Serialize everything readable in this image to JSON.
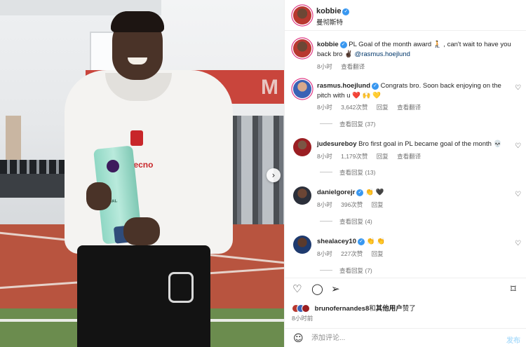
{
  "post": {
    "author": "kobbie",
    "location": "曼彻斯特"
  },
  "caption": {
    "username": "kobbie",
    "text_before": "PL Goal of the month award 🧎 , can't wait to have you back bro ✌🏿 ",
    "mention": "@rasmus.hoejlund",
    "time": "8小时",
    "translate": "查看翻译"
  },
  "comments": [
    {
      "username": "rasmus.hoejlund",
      "verified": true,
      "text": "Congrats bro. Soon back enjoying on the pitch with u ❤️ 🙌 💛",
      "time": "8小时",
      "likes": "3,642次赞",
      "reply": "回复",
      "translate": "查看翻译",
      "view_replies": "查看回复 (37)"
    },
    {
      "username": "judesureboy",
      "verified": false,
      "text": "Bro first goal in PL became goal of the month 💀",
      "time": "8小时",
      "likes": "1,179次赞",
      "reply": "回复",
      "translate": "查看翻译",
      "view_replies": "查看回复 (13)"
    },
    {
      "username": "danielgorejr",
      "verified": true,
      "text": "👏 🖤",
      "time": "8小时",
      "likes": "396次赞",
      "reply": "回复",
      "view_replies": "查看回复 (4)"
    },
    {
      "username": "shealacey10",
      "verified": true,
      "text": "👏 👏",
      "time": "8小时",
      "likes": "227次赞",
      "reply": "回复",
      "view_replies": "查看回复 (7)"
    }
  ],
  "liked_by": {
    "user": "bruno​fernandes8",
    "connector": "和",
    "others": "其他用户",
    "suffix": "赞了"
  },
  "post_time": "8小时前",
  "comment_box": {
    "placeholder": "添加评论...",
    "post_label": "发布"
  },
  "photo": {
    "shirt_text": "Tecno",
    "trophy_text": "GOAL",
    "wall_letter": "M"
  },
  "icons": {
    "like": "heart-icon",
    "comment": "comment-icon",
    "share": "share-icon",
    "save": "bookmark-icon",
    "emoji": "emoji-icon",
    "next": "chevron-right-icon",
    "verified": "verified-badge-icon"
  },
  "colors": {
    "verified": "#3897f0",
    "link": "#00376b",
    "muted": "#737373",
    "post_disabled": "#b2dffc"
  }
}
